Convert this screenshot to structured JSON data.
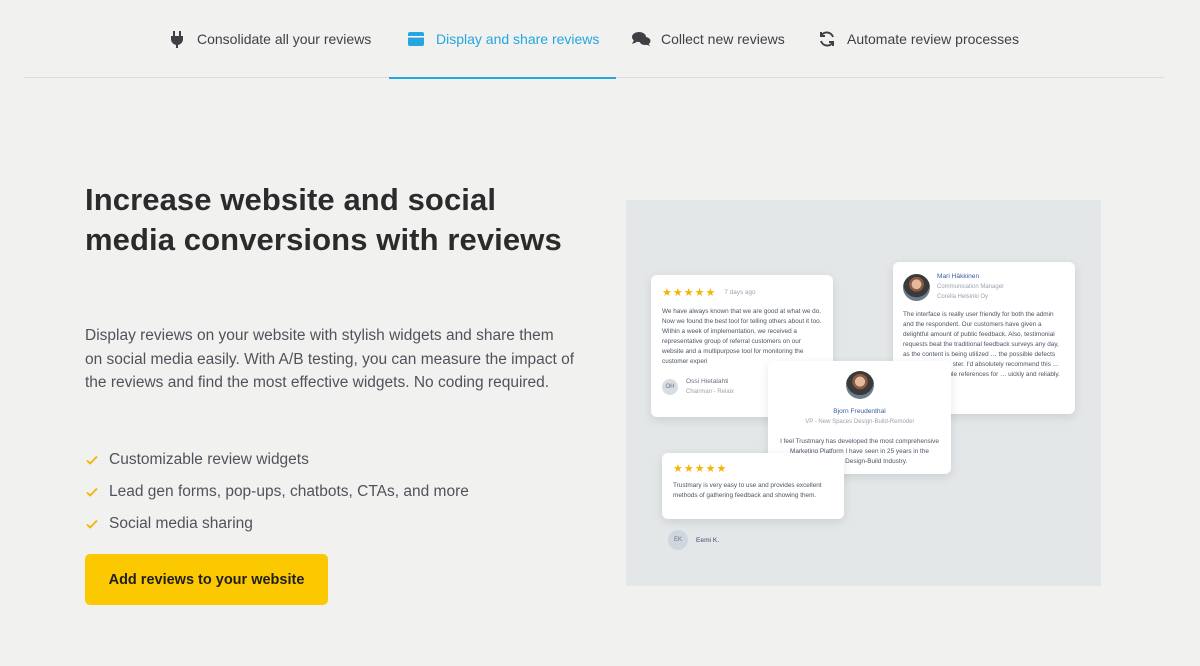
{
  "tabs": [
    {
      "label": "Consolidate all your reviews",
      "icon": "plug-icon",
      "active": false
    },
    {
      "label": "Display and share reviews",
      "icon": "browser-icon",
      "active": true
    },
    {
      "label": "Collect new reviews",
      "icon": "chat-bubbles-icon",
      "active": false
    },
    {
      "label": "Automate review processes",
      "icon": "refresh-icon",
      "active": false
    }
  ],
  "hero": {
    "headline": "Increase website and social media conversions with reviews",
    "description": "Display reviews on your website with stylish widgets and share them on social media easily. With A/B testing, you can measure the impact of the reviews and find the most effective widgets. No coding required.",
    "features": [
      "Customizable review widgets",
      "Lead gen forms, pop-ups, chatbots, CTAs, and more",
      "Social media sharing"
    ],
    "cta_label": "Add reviews to your website"
  },
  "illustration": {
    "review1": {
      "stars": "★★★★★",
      "time": "7 days ago",
      "text": "We have always known that we are good at what we do. Now we found the best tool for telling others about it too. Within a week of implementation, we received a representative group of referral customers on our website and a multipurpose tool for monitoring the customer experi",
      "initials": "OH",
      "name": "Ossi Hietalahti",
      "role": "Chairman - Relaix"
    },
    "review2": {
      "name": "Mari Häkkinen",
      "role": "Communication Manager",
      "company": "Corella Helsinki Oy",
      "text": "The interface is really user friendly for both the admin and the respondent. Our customers have given a delightful amount of public feedback. Also, testimonial requests beat the traditional feedback surveys any day, as the content is being utilized … the possible defects are brought to … ster. I'd absolutely recommend this … wants to get visible references for … uickly and reliably."
    },
    "review3": {
      "name": "Bjorn Freudenthal",
      "role": "VP - New Spaces Design-Build-Remodel",
      "text": "I feel Trustmary has developed the most comprehensive Marketing Platform I have seen in 25 years in the Residential Design-Build Industry."
    },
    "review4": {
      "stars": "★★★★★",
      "text": "Trustmary is very easy to use and provides excellent methods of gathering feedback and showing them.",
      "initials": "EK",
      "name": "Eemi K."
    }
  },
  "colors": {
    "accent": "#25a6e0",
    "cta": "#fcc800",
    "check": "#f5b400",
    "background": "#f1f1f0"
  }
}
